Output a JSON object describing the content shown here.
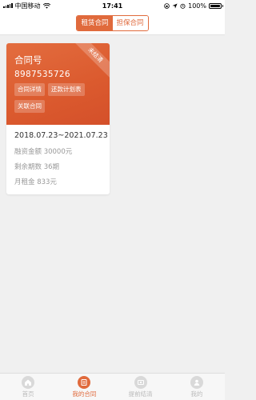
{
  "status_bar": {
    "carrier": "中国移动",
    "time": "17:41",
    "battery": "100%"
  },
  "header": {
    "tabs": [
      {
        "label": "租赁合同",
        "active": true
      },
      {
        "label": "担保合同",
        "active": false
      }
    ]
  },
  "contract_card": {
    "badge": "未结清",
    "title": "合同号",
    "number": "8987535726",
    "buttons": [
      "合同详情",
      "还款计划表",
      "关联合同"
    ],
    "period": "2018.07.23~2021.07.23",
    "financing_amount": "融资金额 30000元",
    "remaining_periods": "剩余期数 36期",
    "monthly_rent": "月租金 833元"
  },
  "tabbar": {
    "items": [
      {
        "label": "首页",
        "icon": "home-icon",
        "active": false
      },
      {
        "label": "我的合同",
        "icon": "contract-icon",
        "active": true
      },
      {
        "label": "提前结清",
        "icon": "settle-icon",
        "active": false
      },
      {
        "label": "我的",
        "icon": "profile-icon",
        "active": false
      }
    ]
  },
  "colors": {
    "accent": "#e06a3c",
    "card_top": "#db5a2e",
    "background": "#f0f0f0"
  }
}
